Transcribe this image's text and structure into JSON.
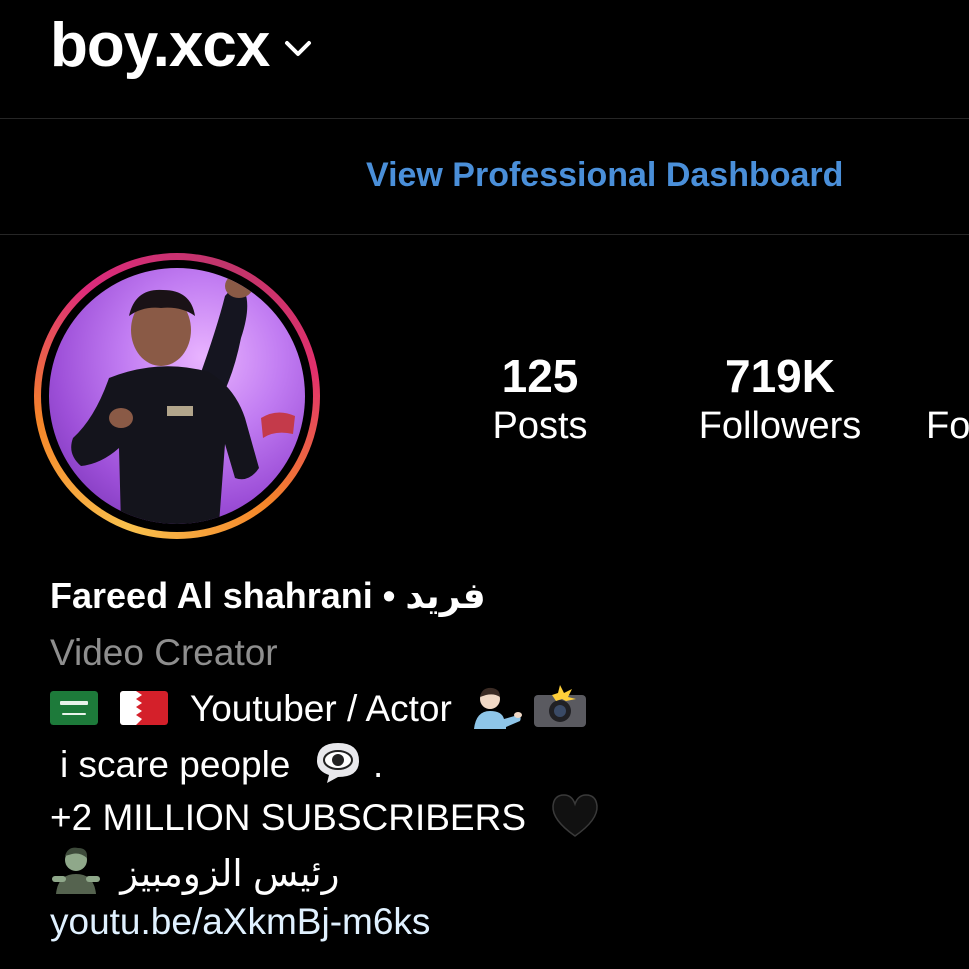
{
  "header": {
    "username": "boy.xcx",
    "switcher_icon": "chevron-down-icon"
  },
  "dashboard": {
    "label": "View Professional Dashboard",
    "color": "#4a8fd9"
  },
  "profile": {
    "avatar_icon": "profile-photo",
    "ring_colors": [
      "#f9c14d",
      "#f58529",
      "#dd2a7b"
    ]
  },
  "stats": [
    {
      "value": "125",
      "label": "Posts"
    },
    {
      "value": "719K",
      "label": "Followers"
    },
    {
      "value": "",
      "label": "Fo"
    }
  ],
  "bio": {
    "name": "Fareed Al shahrani • فريد",
    "category": "Video Creator",
    "line1_text": "Youtuber / Actor",
    "line2_text": "i scare people",
    "line2_suffix": ".",
    "line3_text": "+2 MILLION SUBSCRIBERS",
    "line4_text": "رئيس الزومبيز",
    "link": "youtu.be/aXkmBj-m6ks",
    "icons": [
      "saudi-flag-icon",
      "bahrain-flag-icon",
      "person-tipping-hand-icon",
      "camera-flash-icon",
      "eye-speech-bubble-icon",
      "black-heart-icon",
      "zombie-icon"
    ]
  }
}
